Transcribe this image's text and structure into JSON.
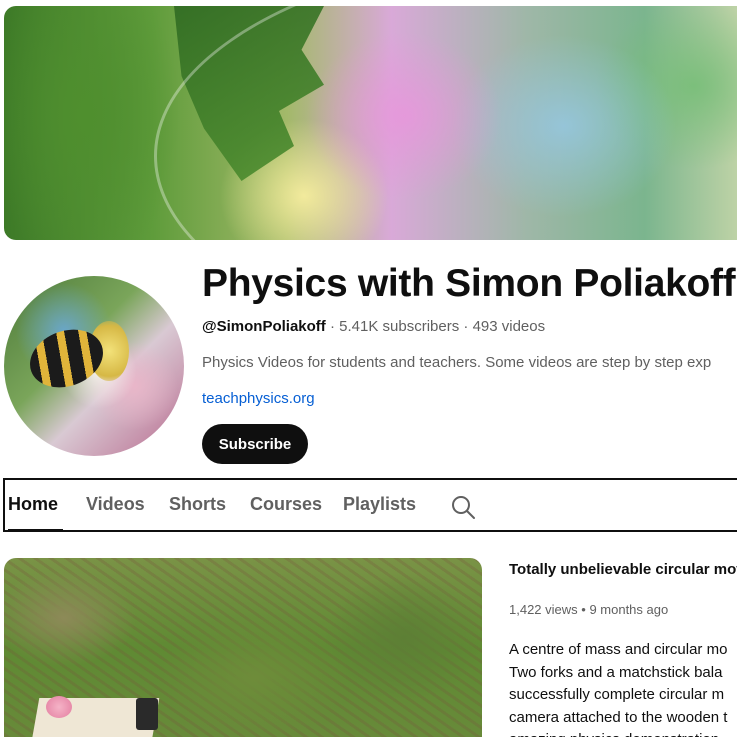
{
  "channel": {
    "name": "Physics with Simon Poliakoff",
    "handle": "@SimonPoliakoff",
    "separator1": " · ",
    "subscribers": "5.41K subscribers",
    "separator2": " · ",
    "videos": "493 videos",
    "description": "Physics Videos for students and teachers.  Some videos are step by step exp",
    "link": "teachphysics.org",
    "subscribe_label": "Subscribe"
  },
  "tabs": [
    {
      "label": "Home",
      "active": true
    },
    {
      "label": "Videos"
    },
    {
      "label": "Shorts"
    },
    {
      "label": "Courses"
    },
    {
      "label": "Playlists"
    }
  ],
  "search_icon": "search-icon",
  "featured_video": {
    "title": "Totally unbelievable circular mot",
    "views": "1,422 views",
    "dot": " • ",
    "age": "9 months ago",
    "description_lines": [
      "A centre of mass and circular mo",
      "Two forks and a matchstick bala",
      "successfully complete circular m",
      "camera attached to the wooden t",
      "amazing physics demonstration"
    ]
  },
  "colors": {
    "text_primary": "#0f0f0f",
    "text_secondary": "#606060",
    "link": "#065fd4",
    "subscribe_bg": "#0f0f0f"
  }
}
